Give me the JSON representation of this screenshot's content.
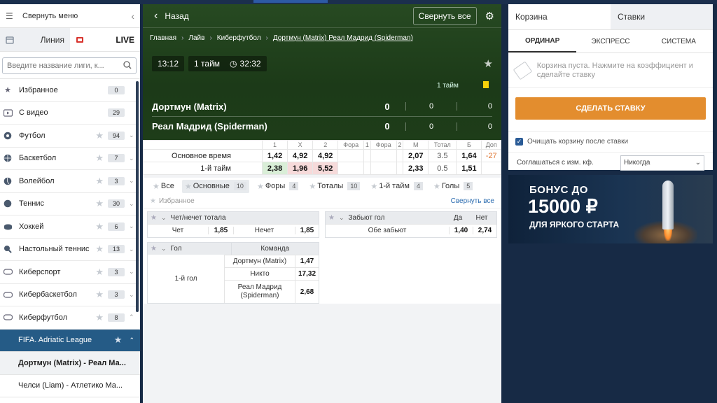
{
  "sidebar": {
    "collapse_label": "Свернуть меню",
    "tabs": [
      {
        "label": "Линия"
      },
      {
        "label": "LIVE"
      }
    ],
    "search_placeholder": "Введите название лиги, к...",
    "items": [
      {
        "label": "Избранное",
        "count": "0",
        "icon": "star-icon"
      },
      {
        "label": "С видео",
        "count": "29",
        "icon": "video-icon"
      },
      {
        "label": "Футбол",
        "count": "94",
        "icon": "soccer-ball-icon"
      },
      {
        "label": "Баскетбол",
        "count": "7",
        "icon": "basketball-icon"
      },
      {
        "label": "Волейбол",
        "count": "3",
        "icon": "volleyball-icon"
      },
      {
        "label": "Теннис",
        "count": "30",
        "icon": "tennis-ball-icon"
      },
      {
        "label": "Хоккей",
        "count": "6",
        "icon": "hockey-puck-icon"
      },
      {
        "label": "Настольный теннис",
        "count": "13",
        "icon": "table-tennis-icon"
      },
      {
        "label": "Киберспорт",
        "count": "3",
        "icon": "gamepad-icon"
      },
      {
        "label": "Кибербаскетбол",
        "count": "3",
        "icon": "gamepad-icon"
      },
      {
        "label": "Киберфутбол",
        "count": "8",
        "icon": "gamepad-icon"
      }
    ],
    "league": "FIFA. Adriatic League",
    "matches": [
      "Дортмун (Matrix) - Реал Ма...",
      "Челси (Liam) - Атлетико Ма..."
    ]
  },
  "header": {
    "back_label": "Назад",
    "collapse_all": "Свернуть все",
    "breadcrumbs": [
      "Главная",
      "Лайв",
      "Киберфутбол",
      "Дортмун (Matrix) Реал Мадрид (Spiderman)"
    ]
  },
  "match": {
    "time": "13:12",
    "period": "1 тайм",
    "clock": "32:32",
    "period_col": "1 тайм",
    "team1": {
      "name": "Дортмун (Matrix)",
      "score": "0",
      "p1": "0",
      "p2": "0"
    },
    "team2": {
      "name": "Реал Мадрид (Spiderman)",
      "score": "0",
      "p1": "0",
      "p2": "0"
    }
  },
  "odds": {
    "headers": [
      "1",
      "X",
      "2",
      "Фора",
      "1",
      "Фора",
      "2",
      "М",
      "Тотал",
      "Б",
      "Доп"
    ],
    "rows": [
      {
        "label": "Основное время",
        "vals": [
          "1,42",
          "4,92",
          "4,92",
          "",
          "",
          "",
          "",
          "2,07",
          "3.5",
          "1,64",
          "-27"
        ]
      },
      {
        "label": "1-й тайм",
        "vals": [
          "2,38",
          "1,96",
          "5,52",
          "",
          "",
          "",
          "",
          "2,33",
          "0.5",
          "1,51",
          ""
        ]
      }
    ]
  },
  "filters": [
    {
      "label": "Все",
      "count": ""
    },
    {
      "label": "Основные",
      "count": "10"
    },
    {
      "label": "Форы",
      "count": "4"
    },
    {
      "label": "Тоталы",
      "count": "10"
    },
    {
      "label": "1-й тайм",
      "count": "4"
    },
    {
      "label": "Голы",
      "count": "5"
    }
  ],
  "favorites_label": "Избранное",
  "collapse_all_link": "Свернуть все",
  "markets": {
    "oddeven": {
      "title": "Чет/нечет тотала",
      "opt1": "Чет",
      "v1": "1,85",
      "opt2": "Нечет",
      "v2": "1,85"
    },
    "btts": {
      "title": "Забьют гол",
      "yes": "Да",
      "no": "Нет",
      "row": "Обе забьют",
      "vyes": "1,40",
      "vno": "2,74"
    },
    "goal": {
      "title": "Гол",
      "col": "Команда",
      "label": "1-й гол",
      "rows": [
        {
          "n": "Дортмун (Matrix)",
          "v": "1,47"
        },
        {
          "n": "Никто",
          "v": "17,32"
        },
        {
          "n": "Реал Мадрид (Spiderman)",
          "v": "2,68"
        }
      ]
    }
  },
  "betslip": {
    "tabs": [
      "Корзина",
      "Ставки"
    ],
    "types": [
      "Ординар",
      "Экспресс",
      "Система"
    ],
    "empty_text": "Корзина пуста. Нажмите на коэффициент и сделайте ставку",
    "make_bet": "СДЕЛАТЬ СТАВКУ",
    "clear_after": "Очищать корзину после ставки",
    "agree_label": "Соглашаться с изм. кф.",
    "agree_value": "Никогда"
  },
  "banner": {
    "line1": "БОНУС ДО",
    "line2": "15000 ₽",
    "line3": "ДЛЯ ЯРКОГО СТАРТА"
  }
}
